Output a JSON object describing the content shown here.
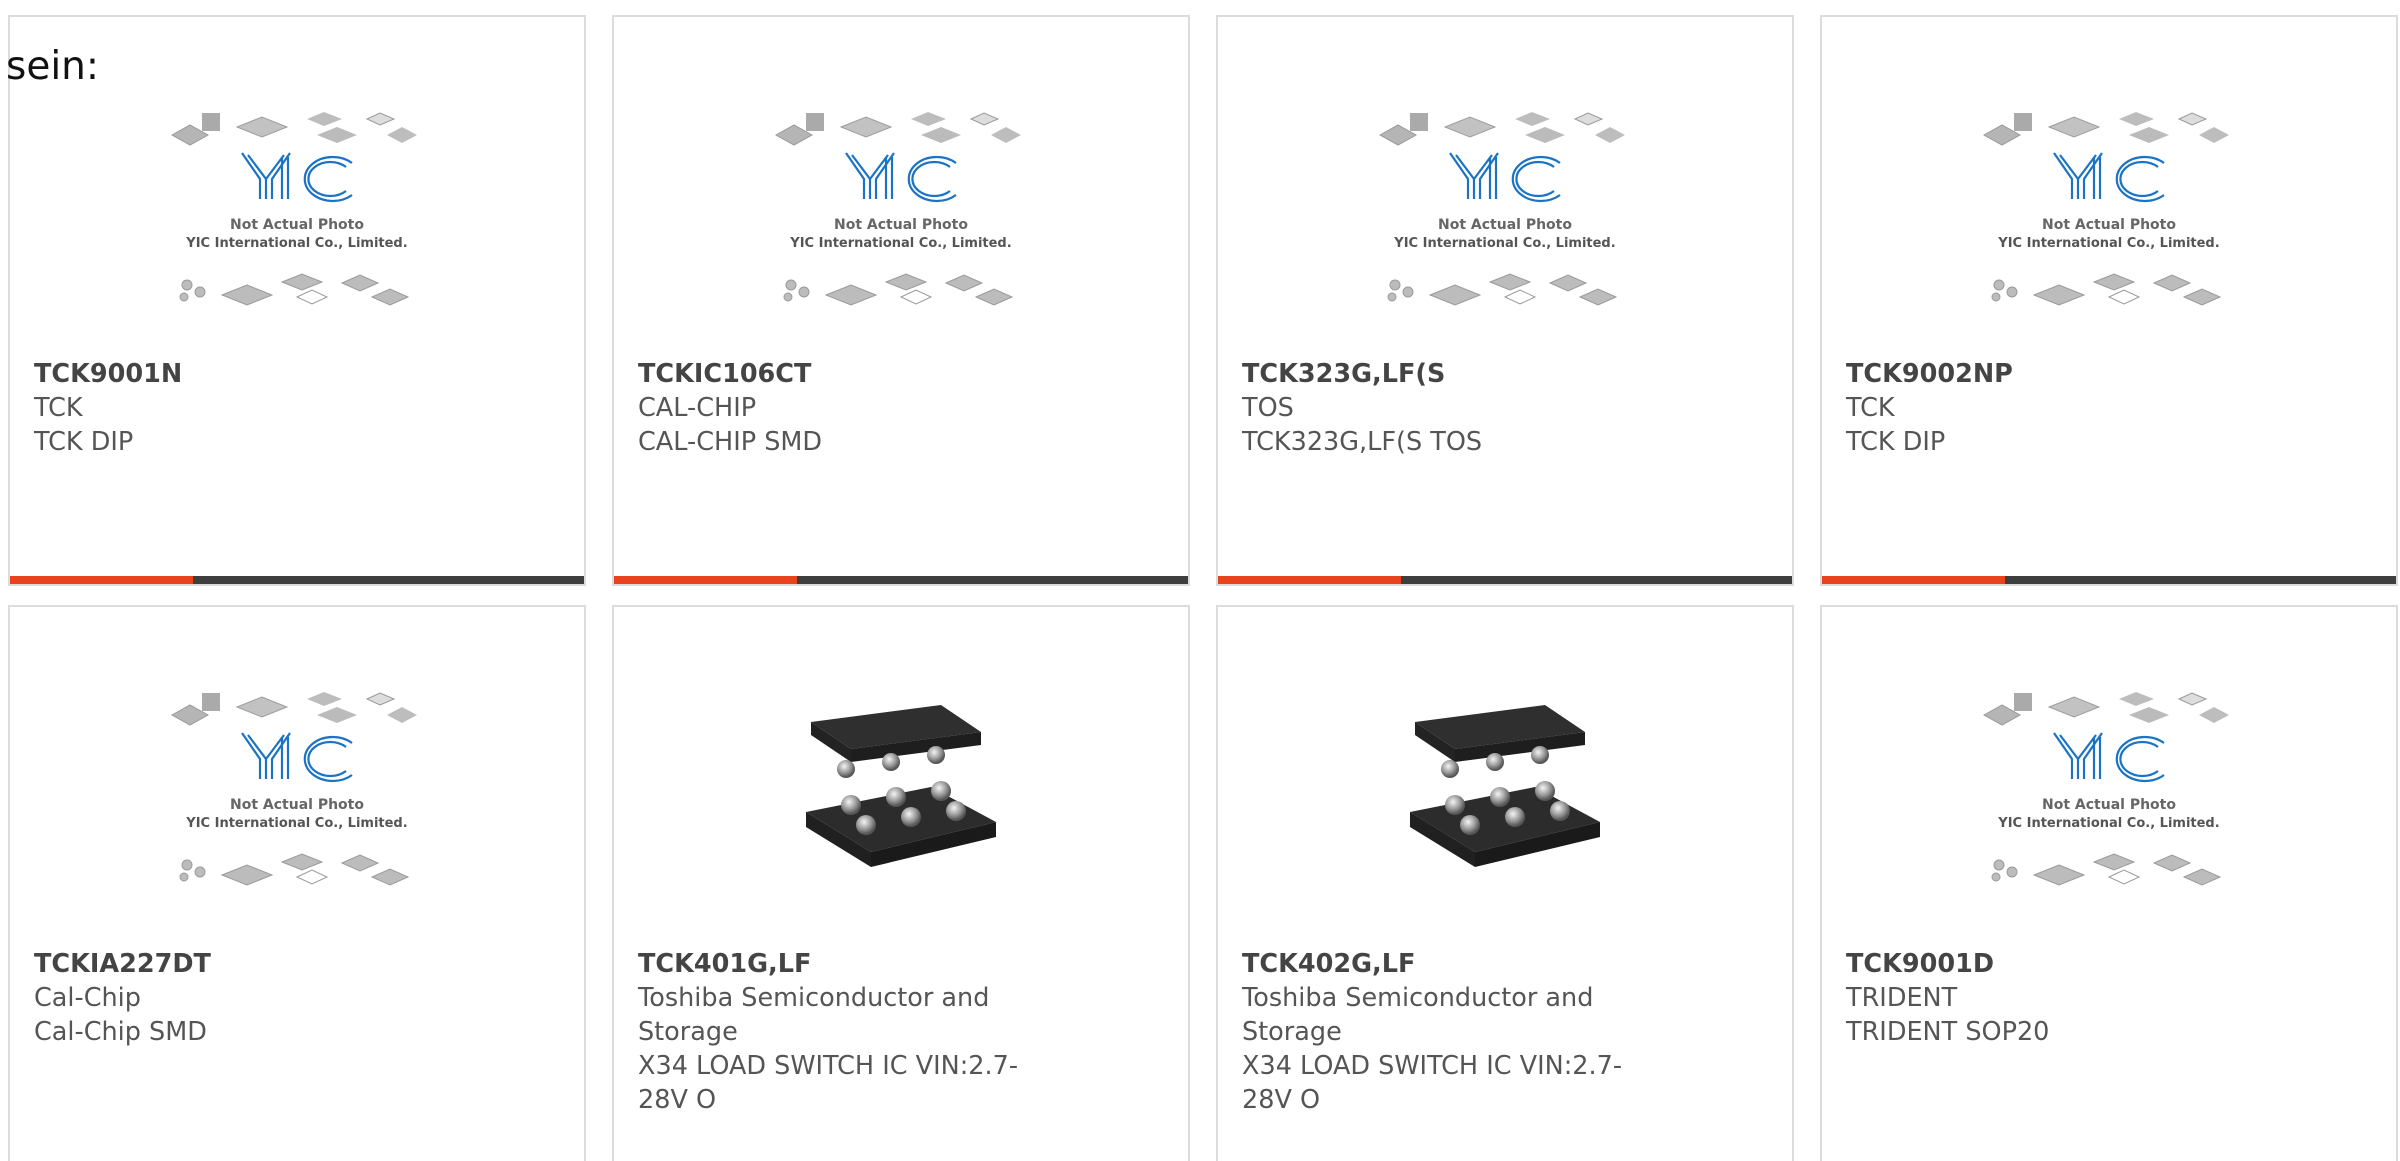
{
  "page": {
    "overflow_text": "sein:"
  },
  "placeholder": {
    "line1": "Not Actual Photo",
    "line2": "YIC International Co., Limited.",
    "logo": "YIC"
  },
  "colors": {
    "accent": "#e8431c",
    "bar": "#3e3e3e",
    "logo": "#1a73c4"
  },
  "products": [
    {
      "pn": "TCK9001N",
      "manufacturer": "TCK",
      "description": "TCK DIP",
      "image": "placeholder"
    },
    {
      "pn": "TCKIC106CT",
      "manufacturer": "CAL-CHIP",
      "description": "CAL-CHIP SMD",
      "image": "placeholder"
    },
    {
      "pn": "TCK323G,LF(S",
      "manufacturer": "TOS",
      "description": "TCK323G,LF(S TOS",
      "image": "placeholder"
    },
    {
      "pn": "TCK9002NP",
      "manufacturer": "TCK",
      "description": "TCK DIP",
      "image": "placeholder"
    },
    {
      "pn": "TCKIA227DT",
      "manufacturer": "Cal-Chip",
      "description": "Cal-Chip SMD",
      "image": "placeholder"
    },
    {
      "pn": "TCK401G,LF",
      "manufacturer": "Toshiba Semiconductor and Storage",
      "description": "X34 LOAD SWITCH IC VIN:2.7-28V O",
      "image": "chip-photo"
    },
    {
      "pn": "TCK402G,LF",
      "manufacturer": "Toshiba Semiconductor and Storage",
      "description": "X34 LOAD SWITCH IC VIN:2.7-28V O",
      "image": "chip-photo"
    },
    {
      "pn": "TCK9001D",
      "manufacturer": "TRIDENT",
      "description": "TRIDENT SOP20",
      "image": "placeholder"
    }
  ]
}
